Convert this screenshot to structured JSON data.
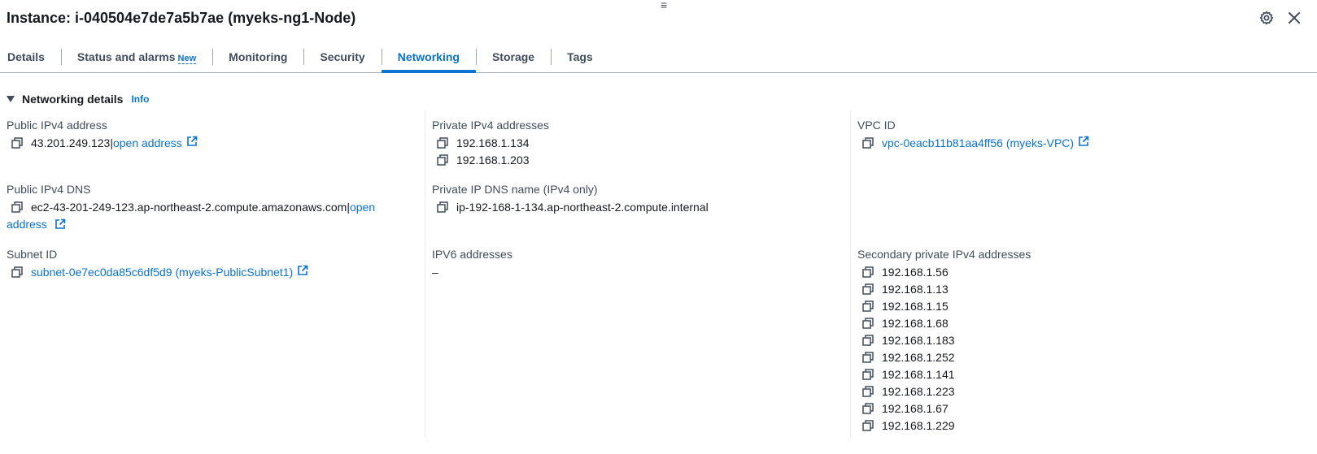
{
  "header": {
    "title": "Instance: i-040504e7de7a5b7ae (myeks-ng1-Node)",
    "drag_handle": "≡"
  },
  "tabs": [
    {
      "label": "Details",
      "active": false
    },
    {
      "label": "Status and alarms",
      "badge": "New",
      "active": false
    },
    {
      "label": "Monitoring",
      "active": false
    },
    {
      "label": "Security",
      "active": false
    },
    {
      "label": "Networking",
      "active": true
    },
    {
      "label": "Storage",
      "active": false
    },
    {
      "label": "Tags",
      "active": false
    }
  ],
  "section": {
    "title": "Networking details",
    "info": "Info"
  },
  "fields": {
    "public_ipv4": {
      "label": "Public IPv4 address",
      "value": "43.201.249.123",
      "separator": " |",
      "link": "open address"
    },
    "public_dns": {
      "label": "Public IPv4 DNS",
      "value": "ec2-43-201-249-123.ap-northeast-2.compute.amazonaws.com",
      "separator": " |",
      "link_part1": "open",
      "link_part2": "address"
    },
    "subnet": {
      "label": "Subnet ID",
      "link": "subnet-0e7ec0da85c6df5d9 (myeks-PublicSubnet1)"
    },
    "private_ipv4": {
      "label": "Private IPv4 addresses",
      "values": [
        "192.168.1.134",
        "192.168.1.203"
      ]
    },
    "private_dns": {
      "label": "Private IP DNS name (IPv4 only)",
      "value": "ip-192-168-1-134.ap-northeast-2.compute.internal"
    },
    "ipv6": {
      "label": "IPV6 addresses",
      "value": "–"
    },
    "vpc": {
      "label": "VPC ID",
      "link": "vpc-0eacb11b81aa4ff56 (myeks-VPC)"
    },
    "secondary_ipv4": {
      "label": "Secondary private IPv4 addresses",
      "values": [
        "192.168.1.56",
        "192.168.1.13",
        "192.168.1.15",
        "192.168.1.68",
        "192.168.1.183",
        "192.168.1.252",
        "192.168.1.141",
        "192.168.1.223",
        "192.168.1.67",
        "192.168.1.229"
      ]
    }
  },
  "colors": {
    "link": "#0972d3",
    "text": "#16191f",
    "label": "#414d5c"
  },
  "icons": {
    "copy": "copy-icon",
    "external": "external-link-icon",
    "settings": "gear-icon",
    "close": "close-icon",
    "caret": "caret-down-icon"
  }
}
